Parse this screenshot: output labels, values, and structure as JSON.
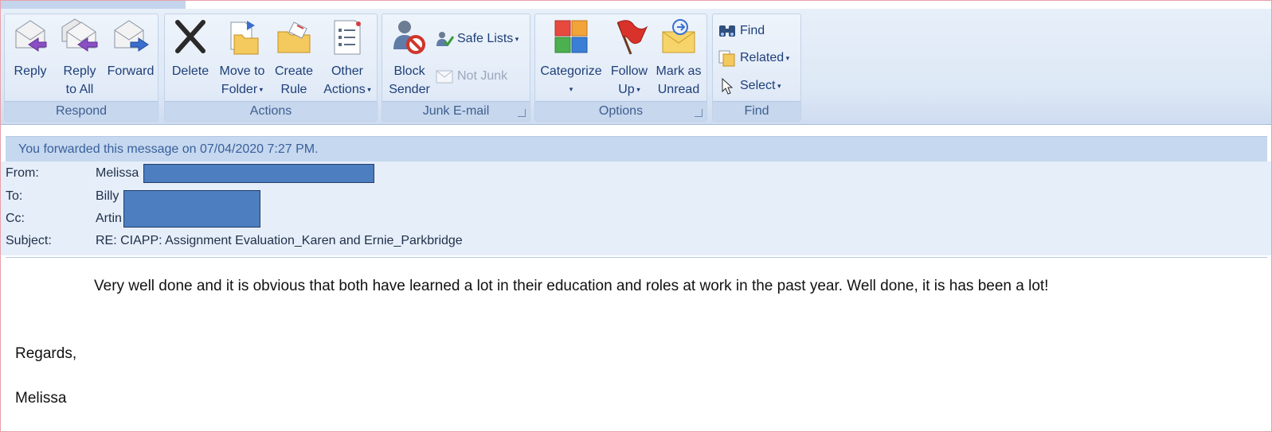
{
  "ribbon": {
    "respond": {
      "label": "Respond",
      "reply": "Reply",
      "reply_all_1": "Reply",
      "reply_all_2": "to All",
      "forward": "Forward"
    },
    "actions": {
      "label": "Actions",
      "delete": "Delete",
      "move_1": "Move to",
      "move_2": "Folder",
      "create_1": "Create",
      "create_2": "Rule",
      "other_1": "Other",
      "other_2": "Actions"
    },
    "junk": {
      "label": "Junk E-mail",
      "block_1": "Block",
      "block_2": "Sender",
      "safe_lists": "Safe Lists",
      "not_junk": "Not Junk"
    },
    "options": {
      "label": "Options",
      "categorize": "Categorize",
      "follow_1": "Follow",
      "follow_2": "Up",
      "mark_1": "Mark as",
      "mark_2": "Unread"
    },
    "find": {
      "label": "Find",
      "find": "Find",
      "related": "Related",
      "select": "Select"
    }
  },
  "infobar": "You forwarded this message on 07/04/2020 7:27 PM.",
  "header": {
    "from_label": "From:",
    "from_value": "Melissa",
    "to_label": "To:",
    "to_value": "Billy",
    "cc_label": "Cc:",
    "cc_value": "Artin",
    "subject_label": "Subject:",
    "subject_value": "RE: CIAPP: Assignment Evaluation_Karen and Ernie_Parkbridge"
  },
  "body": {
    "line1": "Very well done and it is obvious that both have learned a lot in their education and roles at work in the past year.  Well done, it is has been a lot!",
    "regards": "Regards,",
    "signature": "Melissa"
  },
  "colors": {
    "ribbon_text": "#1e3f78",
    "group_label": "#3e5f8e",
    "infobar_bg": "#c5d8ef",
    "redaction": "#4c7ec0"
  }
}
